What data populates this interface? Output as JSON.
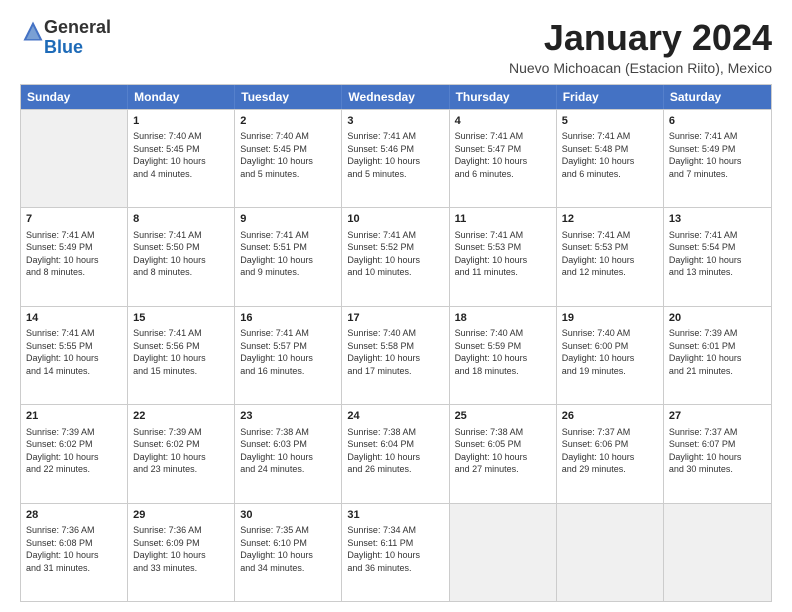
{
  "logo": {
    "general": "General",
    "blue": "Blue"
  },
  "header": {
    "month": "January 2024",
    "location": "Nuevo Michoacan (Estacion Riito), Mexico"
  },
  "days": [
    "Sunday",
    "Monday",
    "Tuesday",
    "Wednesday",
    "Thursday",
    "Friday",
    "Saturday"
  ],
  "rows": [
    [
      {
        "day": "",
        "info": ""
      },
      {
        "day": "1",
        "info": "Sunrise: 7:40 AM\nSunset: 5:45 PM\nDaylight: 10 hours\nand 4 minutes."
      },
      {
        "day": "2",
        "info": "Sunrise: 7:40 AM\nSunset: 5:45 PM\nDaylight: 10 hours\nand 5 minutes."
      },
      {
        "day": "3",
        "info": "Sunrise: 7:41 AM\nSunset: 5:46 PM\nDaylight: 10 hours\nand 5 minutes."
      },
      {
        "day": "4",
        "info": "Sunrise: 7:41 AM\nSunset: 5:47 PM\nDaylight: 10 hours\nand 6 minutes."
      },
      {
        "day": "5",
        "info": "Sunrise: 7:41 AM\nSunset: 5:48 PM\nDaylight: 10 hours\nand 6 minutes."
      },
      {
        "day": "6",
        "info": "Sunrise: 7:41 AM\nSunset: 5:49 PM\nDaylight: 10 hours\nand 7 minutes."
      }
    ],
    [
      {
        "day": "7",
        "info": "Sunrise: 7:41 AM\nSunset: 5:49 PM\nDaylight: 10 hours\nand 8 minutes."
      },
      {
        "day": "8",
        "info": "Sunrise: 7:41 AM\nSunset: 5:50 PM\nDaylight: 10 hours\nand 8 minutes."
      },
      {
        "day": "9",
        "info": "Sunrise: 7:41 AM\nSunset: 5:51 PM\nDaylight: 10 hours\nand 9 minutes."
      },
      {
        "day": "10",
        "info": "Sunrise: 7:41 AM\nSunset: 5:52 PM\nDaylight: 10 hours\nand 10 minutes."
      },
      {
        "day": "11",
        "info": "Sunrise: 7:41 AM\nSunset: 5:53 PM\nDaylight: 10 hours\nand 11 minutes."
      },
      {
        "day": "12",
        "info": "Sunrise: 7:41 AM\nSunset: 5:53 PM\nDaylight: 10 hours\nand 12 minutes."
      },
      {
        "day": "13",
        "info": "Sunrise: 7:41 AM\nSunset: 5:54 PM\nDaylight: 10 hours\nand 13 minutes."
      }
    ],
    [
      {
        "day": "14",
        "info": "Sunrise: 7:41 AM\nSunset: 5:55 PM\nDaylight: 10 hours\nand 14 minutes."
      },
      {
        "day": "15",
        "info": "Sunrise: 7:41 AM\nSunset: 5:56 PM\nDaylight: 10 hours\nand 15 minutes."
      },
      {
        "day": "16",
        "info": "Sunrise: 7:41 AM\nSunset: 5:57 PM\nDaylight: 10 hours\nand 16 minutes."
      },
      {
        "day": "17",
        "info": "Sunrise: 7:40 AM\nSunset: 5:58 PM\nDaylight: 10 hours\nand 17 minutes."
      },
      {
        "day": "18",
        "info": "Sunrise: 7:40 AM\nSunset: 5:59 PM\nDaylight: 10 hours\nand 18 minutes."
      },
      {
        "day": "19",
        "info": "Sunrise: 7:40 AM\nSunset: 6:00 PM\nDaylight: 10 hours\nand 19 minutes."
      },
      {
        "day": "20",
        "info": "Sunrise: 7:39 AM\nSunset: 6:01 PM\nDaylight: 10 hours\nand 21 minutes."
      }
    ],
    [
      {
        "day": "21",
        "info": "Sunrise: 7:39 AM\nSunset: 6:02 PM\nDaylight: 10 hours\nand 22 minutes."
      },
      {
        "day": "22",
        "info": "Sunrise: 7:39 AM\nSunset: 6:02 PM\nDaylight: 10 hours\nand 23 minutes."
      },
      {
        "day": "23",
        "info": "Sunrise: 7:38 AM\nSunset: 6:03 PM\nDaylight: 10 hours\nand 24 minutes."
      },
      {
        "day": "24",
        "info": "Sunrise: 7:38 AM\nSunset: 6:04 PM\nDaylight: 10 hours\nand 26 minutes."
      },
      {
        "day": "25",
        "info": "Sunrise: 7:38 AM\nSunset: 6:05 PM\nDaylight: 10 hours\nand 27 minutes."
      },
      {
        "day": "26",
        "info": "Sunrise: 7:37 AM\nSunset: 6:06 PM\nDaylight: 10 hours\nand 29 minutes."
      },
      {
        "day": "27",
        "info": "Sunrise: 7:37 AM\nSunset: 6:07 PM\nDaylight: 10 hours\nand 30 minutes."
      }
    ],
    [
      {
        "day": "28",
        "info": "Sunrise: 7:36 AM\nSunset: 6:08 PM\nDaylight: 10 hours\nand 31 minutes."
      },
      {
        "day": "29",
        "info": "Sunrise: 7:36 AM\nSunset: 6:09 PM\nDaylight: 10 hours\nand 33 minutes."
      },
      {
        "day": "30",
        "info": "Sunrise: 7:35 AM\nSunset: 6:10 PM\nDaylight: 10 hours\nand 34 minutes."
      },
      {
        "day": "31",
        "info": "Sunrise: 7:34 AM\nSunset: 6:11 PM\nDaylight: 10 hours\nand 36 minutes."
      },
      {
        "day": "",
        "info": ""
      },
      {
        "day": "",
        "info": ""
      },
      {
        "day": "",
        "info": ""
      }
    ]
  ]
}
